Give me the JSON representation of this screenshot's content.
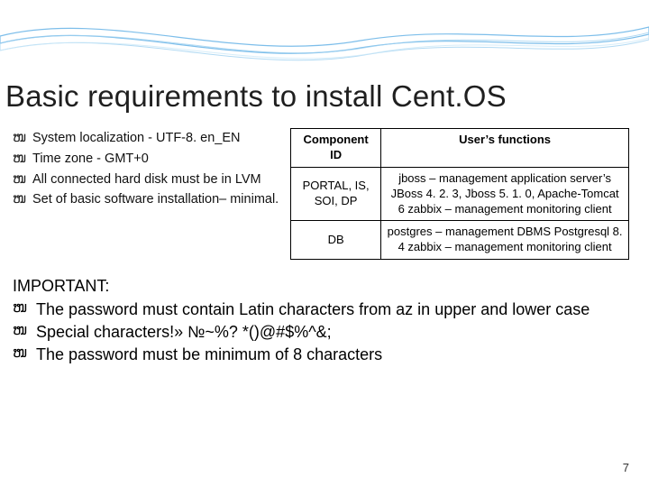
{
  "title": "Basic requirements to install Cent.OS",
  "bullet_glyph": "ໜ",
  "left_bullets": [
    "System localization - UTF-8. en_EN",
    "Time zone - GMT+0",
    "All connected hard disk must be in LVM",
    "Set of basic software installation– minimal."
  ],
  "table": {
    "headers": [
      "Component ID",
      "User’s functions"
    ],
    "rows": [
      {
        "id": "PORTAL, IS, SOI, DP",
        "func": "jboss – management application server’s JBoss 4. 2. 3, Jboss 5. 1. 0, Apache-Tomcat 6 zabbix – management monitoring client"
      },
      {
        "id": "DB",
        "func": "postgres – management DBMS Postgresql 8. 4 zabbix – management monitoring client"
      }
    ]
  },
  "important_label": "IMPORTANT:",
  "important_items": [
    "The password must contain Latin characters from az in upper and lower case",
    "Special characters!» №~%? *()@#$%^&;",
    "The password must be minimum of 8 characters"
  ],
  "page_number": "7"
}
